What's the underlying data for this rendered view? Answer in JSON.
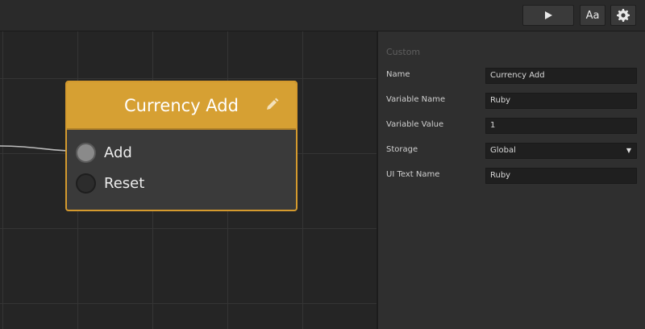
{
  "toolbar": {
    "play_icon": "play-icon",
    "font_label": "Aa",
    "settings_icon": "gear-icon"
  },
  "node": {
    "title": "Currency Add",
    "header_color": "#d6a033",
    "edit_icon": "pencil-icon",
    "ports": [
      {
        "label": "Add",
        "connected": true
      },
      {
        "label": "Reset",
        "connected": false
      }
    ]
  },
  "inspector": {
    "section": "Custom",
    "fields": [
      {
        "label": "Name",
        "value": "Currency Add"
      },
      {
        "label": "Variable Name",
        "value": "Ruby"
      },
      {
        "label": "Variable Value",
        "value": "1"
      },
      {
        "label": "Storage",
        "value": "Global"
      },
      {
        "label": "UI Text Name",
        "value": "Ruby"
      }
    ]
  }
}
